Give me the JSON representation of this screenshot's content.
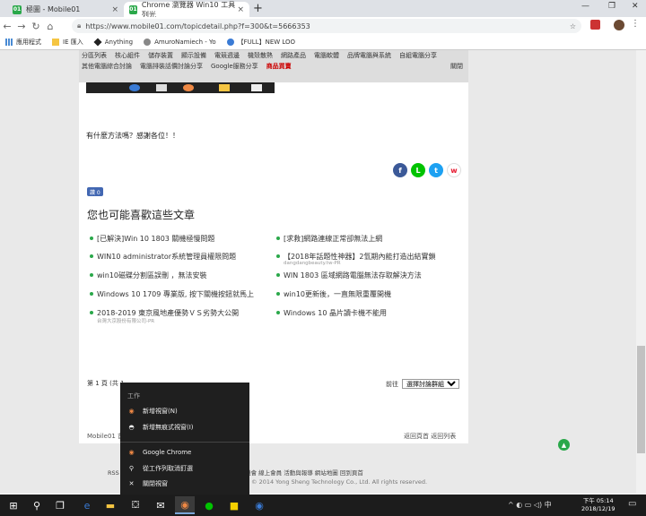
{
  "browser": {
    "tabs": [
      {
        "label": "極圖 - Mobile01",
        "favicon": "01"
      },
      {
        "label": "Chrome 瀏覽器 Win10 工具列光",
        "favicon": "01"
      }
    ],
    "new_tab": "+",
    "window_controls": [
      "—",
      "❐",
      "✕"
    ],
    "url": "https://www.mobile01.com/topicdetail.php?f=300&t=5666353",
    "bookmarks": [
      "應用程式",
      "IE 匯入",
      "Anything",
      "AmuroNamiech - Yo",
      "【FULL】NEW LOO"
    ]
  },
  "catnav": {
    "row1": [
      "分區列表",
      "核心組件",
      "儲存裝置",
      "顯示設備",
      "電競週邊",
      "機殼散熱",
      "網路產品",
      "電腦軟體",
      "品牌電腦與系統",
      "自組電腦分享"
    ],
    "row2": [
      "其他電腦綜合討論",
      "電腦排裝話價討論分享",
      "Google服務分享"
    ],
    "hot": "商品買賣",
    "about": "關閉"
  },
  "post": {
    "question": "有什麼方法嗎？感謝各位！！",
    "like_label": "讚 0"
  },
  "related": {
    "title": "您也可能喜歡這些文章",
    "left": [
      {
        "text": "[已解決]Win 10 1803 關機極慢問題",
        "sub": ""
      },
      {
        "text": "WIN10 administrator系統管理員權限問題",
        "sub": ""
      },
      {
        "text": "win10磁碟分割區誤刪 ，無法安裝",
        "sub": ""
      },
      {
        "text": "Windows 10 1709 專業版, 按下關機按鈕就馬上",
        "sub": ""
      },
      {
        "text": "2018-2019 東京風地產優勢ＶＳ劣勢大公開",
        "sub": "台灣大京股份有限公司-PR"
      }
    ],
    "right": [
      {
        "text": "[求救]網路連線正常卻無法上網",
        "sub": ""
      },
      {
        "text": "【2018年話題性神器】2氫期內能打造出結實鎖",
        "sub": "dangdangbeauty.tw-PR"
      },
      {
        "text": "WIN 1803 區域網路電腦無法存取解決方法",
        "sub": ""
      },
      {
        "text": "win10更新後，一直無限重覆開機",
        "sub": ""
      },
      {
        "text": "Windows 10 晶片讀卡機不能用",
        "sub": ""
      }
    ]
  },
  "pager": {
    "page_text": "第 1 頁 (共 1",
    "goto_label": "前往",
    "select_value": "選擇討論群組"
  },
  "footer": {
    "left": "Mobile01 首",
    "right": "返回頁首  返回列表",
    "links": "RSS     服務條款  隱私權政策  合作與廣告  聯絡我們  工作機會  線上會員  活動與報導  網站地圖  回到頁首",
    "copyright": "© 2014 Yong Sheng Technology Co., Ltd. All rights reserved."
  },
  "jumplist": {
    "header": "工作",
    "tasks": [
      {
        "icon": "chrome-icon",
        "label": "新增視窗(N)"
      },
      {
        "icon": "incognito-icon",
        "label": "新增無痕式視窗(I)"
      }
    ],
    "app": {
      "icon": "chrome-icon",
      "label": "Google Chrome"
    },
    "unpin": {
      "icon": "unpin-icon",
      "label": "從工作列取消釘選"
    },
    "close": {
      "icon": "close-icon",
      "label": "關閉視窗"
    }
  },
  "taskbar": {
    "tray_text": "^ ◐ ▭ ◁) 中",
    "time": "下午 05:14",
    "date": "2018/12/19"
  },
  "colors": {
    "accent_green": "#2aa84a",
    "facebook": "#3b5998",
    "line": "#00c300",
    "twitter": "#1da1f2",
    "weibo": "#e6162d"
  }
}
